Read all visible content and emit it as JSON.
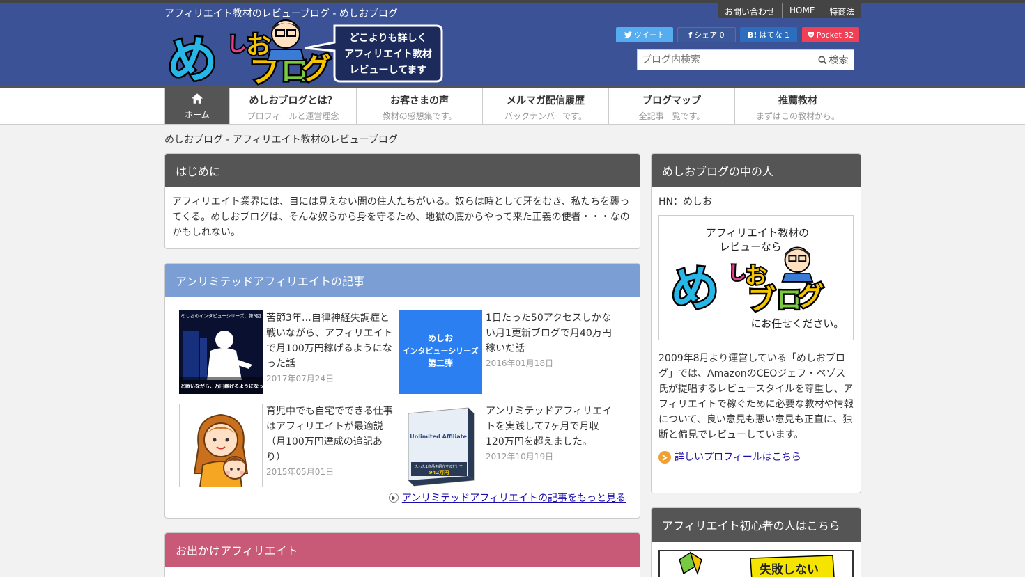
{
  "header": {
    "site_description": "アフィリエイト教材のレビューブログ - めしおブログ",
    "logo_main": "めしおブログ",
    "logo_bubble": [
      "どこよりも詳しく",
      "アフィリエイト教材",
      "レビューしてます"
    ],
    "top_links": [
      "お問い合わせ",
      "HOME",
      "特商法"
    ],
    "share": {
      "twitter": "ツイート",
      "facebook": "シェア 0",
      "hatena": "はてな 1",
      "pocket": "Pocket 32"
    },
    "search": {
      "placeholder": "ブログ内検索",
      "button": "検索"
    }
  },
  "nav": {
    "home": "ホーム",
    "items": [
      {
        "title": "めしおブログとは？",
        "sub": "プロフィールと運営理念"
      },
      {
        "title": "お客さまの声",
        "sub": "教材の感想集です。"
      },
      {
        "title": "メルマガ配信履歴",
        "sub": "バックナンバーです。"
      },
      {
        "title": "ブログマップ",
        "sub": "全記事一覧です。"
      },
      {
        "title": "推薦教材",
        "sub": "まずはこの教材から。"
      }
    ]
  },
  "breadcrumb": "めしおブログ - アフィリエイト教材のレビューブログ",
  "intro": {
    "heading": "はじめに",
    "text": "アフィリエイト業界には、目には見えない闇の住人たちがいる。奴らは時として牙をむき、私たちを襲ってくる。めしおブログは、そんな奴らから身を守るため、地獄の底からやって来た正義の使者・・・なのかもしれない。"
  },
  "unlimited": {
    "heading": "アンリミテッドアフィリエイトの記事",
    "articles": [
      {
        "title": "苦節3年…自律神経失調症と戦いながら、アフィリエイトで月100万円稼げるようになった話",
        "date": "2017年07月24日",
        "thumb_caption": "めしおのインタビューシリーズ：第3回",
        "thumb_overlay": "と戦いながら、万円稼げるようになった話"
      },
      {
        "title": "1日たった50アクセスしかない月1更新ブログで月40万円稼いだ話",
        "date": "2016年01月18日",
        "thumb_text": [
          "めしお",
          "インタビューシリーズ",
          "第二弾"
        ]
      },
      {
        "title": "育児中でも自宅でできる仕事はアフィリエイトが最適説（月100万円達成の追記あり）",
        "date": "2015年05月01日"
      },
      {
        "title": "アンリミテッドアフィリエイトを実践して7ヶ月で月収120万円を超えました。",
        "date": "2012年10月19日",
        "thumb_text": [
          "Unlimited Affiliate",
          "たった1商品を紹介するだけで",
          "942万円"
        ]
      }
    ],
    "more": "アンリミテッドアフィリエイトの記事をもっと見る"
  },
  "outing": {
    "heading": "お出かけアフィリエイト"
  },
  "sidebar": {
    "profile": {
      "heading": "めしおブログの中の人",
      "hn": "HN：めしお",
      "img_top": [
        "アフィリエイト教材の",
        "レビューなら"
      ],
      "img_bottom": "にお任せください。",
      "text": "2009年8月より運営している「めしおブログ」では、AmazonのCEOジェフ・ベゾス氏が提唱するレビュースタイルを尊重し、アフィリエイトで稼ぐために必要な教材や情報について、良い意見も悪い意見も正直に、独断と偏見でレビューしています。",
      "link": "詳しいプロフィールはこちら"
    },
    "beginner": {
      "heading": "アフィリエイト初心者の人はこちら",
      "banner_text": "失敗しない"
    }
  }
}
